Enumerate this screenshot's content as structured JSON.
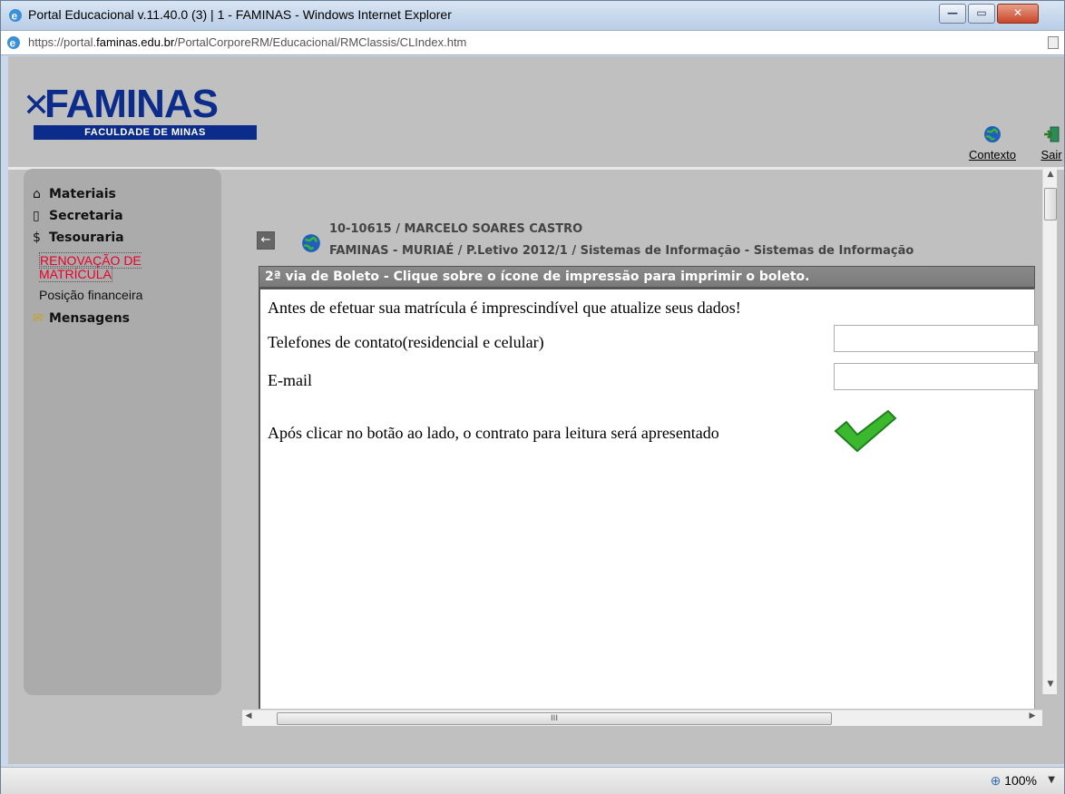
{
  "window": {
    "title": "Portal Educacional v.11.40.0 (3) | 1 - FAMINAS - Windows Internet Explorer",
    "address": {
      "pre": "https://portal.",
      "bold": "faminas.edu.br",
      "post": "/PortalCorporeRM/Educacional/RMClassis/CLIndex.htm"
    }
  },
  "header": {
    "logo_main": "FAMINAS",
    "logo_sub": "FACULDADE DE MINAS",
    "contexto_label": "Contexto",
    "sair_label": "Sair"
  },
  "sidebar": {
    "materiais": "Materiais",
    "secretaria": "Secretaria",
    "tesouraria": "Tesouraria",
    "renovacao": "RENOVAÇÃO DE MATRÍCULA",
    "posicao": "Posição financeira",
    "mensagens": "Mensagens"
  },
  "student": {
    "line1": "10-10615 / MARCELO SOARES CASTRO",
    "line2": "FAMINAS - MURIAÉ / P.Letivo 2012/1  / Sistemas de Informação - Sistemas de Informação"
  },
  "banner": "2ª via de Boleto - Clique sobre o ícone de impressão para imprimir o boleto.",
  "content": {
    "notice": "Antes de efetuar sua matrícula é imprescindível que atualize seus dados!",
    "tel_label": "Telefones de contato(residencial e celular)",
    "tel_value": "",
    "email_label": "E-mail",
    "email_value": "",
    "after_text": "Após clicar no botão ao lado, o contrato para leitura será apresentado"
  },
  "status": {
    "zoom": "100%"
  },
  "colors": {
    "brand": "#0b2c8a",
    "highlight": "#e8002a",
    "check": "#3cb82e"
  }
}
